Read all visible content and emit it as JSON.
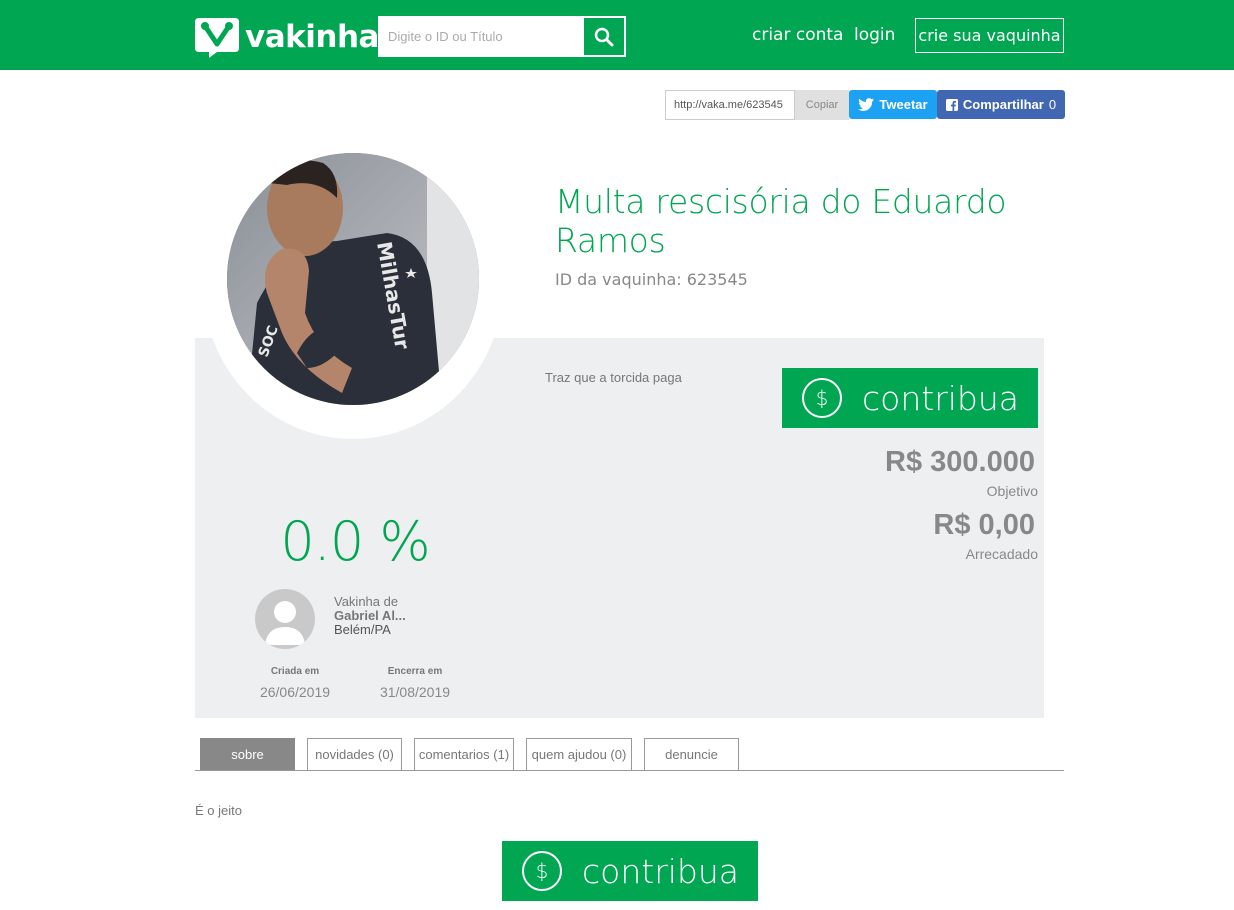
{
  "header": {
    "brand": "vakinha",
    "search_placeholder": "Digite o ID ou Título",
    "nav": {
      "create_account": "criar conta",
      "login": "login",
      "create_vakinha": "crie sua vaquinha"
    }
  },
  "share": {
    "url": "http://vaka.me/623545",
    "copy": "Copiar",
    "tweet": "Tweetar",
    "facebook": "Compartilhar",
    "facebook_count": "0"
  },
  "campaign": {
    "title": "Multa rescisória do Eduardo Ramos",
    "id_label": "ID da vaquinha: 623545",
    "subtitle": "Traz que a torcida paga",
    "contribute_label": "contribua",
    "goal_amount": "R$ 300.000",
    "goal_label": "Objetivo",
    "raised_amount": "R$ 0,00",
    "raised_label": "Arrecadado",
    "percent": "0.0 %",
    "owner_prefix": "Vakinha de",
    "owner_name": "Gabriel Al...",
    "owner_location": "Belém/PA",
    "created_label": "Criada em",
    "created_date": "26/06/2019",
    "ends_label": "Encerra em",
    "ends_date": "31/08/2019"
  },
  "photo": {
    "shirt_text": "MilhasTur"
  },
  "tabs": [
    {
      "label": "sobre"
    },
    {
      "label": "novidades (0)"
    },
    {
      "label": "comentarios (1)"
    },
    {
      "label": "quem ajudou (0)"
    },
    {
      "label": "denuncie"
    }
  ],
  "about_text": "É o jeito",
  "colors": {
    "brand_green": "#00a651",
    "panel_gray": "#eeeff0",
    "twitter": "#1da1f2",
    "facebook": "#4267b2"
  }
}
